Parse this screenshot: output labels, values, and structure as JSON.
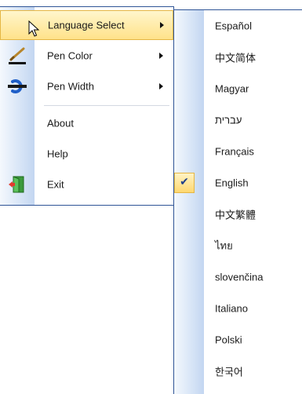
{
  "main_menu": {
    "items": [
      {
        "label": "Language Select",
        "has_submenu": true,
        "highlighted": true
      },
      {
        "label": "Pen Color",
        "has_submenu": true,
        "icon": "pen-color-icon"
      },
      {
        "label": "Pen Width",
        "has_submenu": true,
        "icon": "pen-width-icon"
      },
      {
        "label": "About",
        "has_submenu": false
      },
      {
        "label": "Help",
        "has_submenu": false
      },
      {
        "label": "Exit",
        "has_submenu": false,
        "icon": "exit-door-icon"
      }
    ]
  },
  "language_submenu": {
    "items": [
      {
        "label": "Español"
      },
      {
        "label": "中文简体"
      },
      {
        "label": "Magyar"
      },
      {
        "label": "עברית"
      },
      {
        "label": "Français"
      },
      {
        "label": "English",
        "checked": true
      },
      {
        "label": "中文繁體"
      },
      {
        "label": "ไทย"
      },
      {
        "label": "slovenčina"
      },
      {
        "label": "Italiano"
      },
      {
        "label": "Polski"
      },
      {
        "label": "한국어"
      }
    ]
  },
  "colors": {
    "menu_border": "#2f5496",
    "hover_fill": "#ffe28a",
    "hover_border": "#e5b644",
    "gutter_blue": "#c3d6f1"
  }
}
